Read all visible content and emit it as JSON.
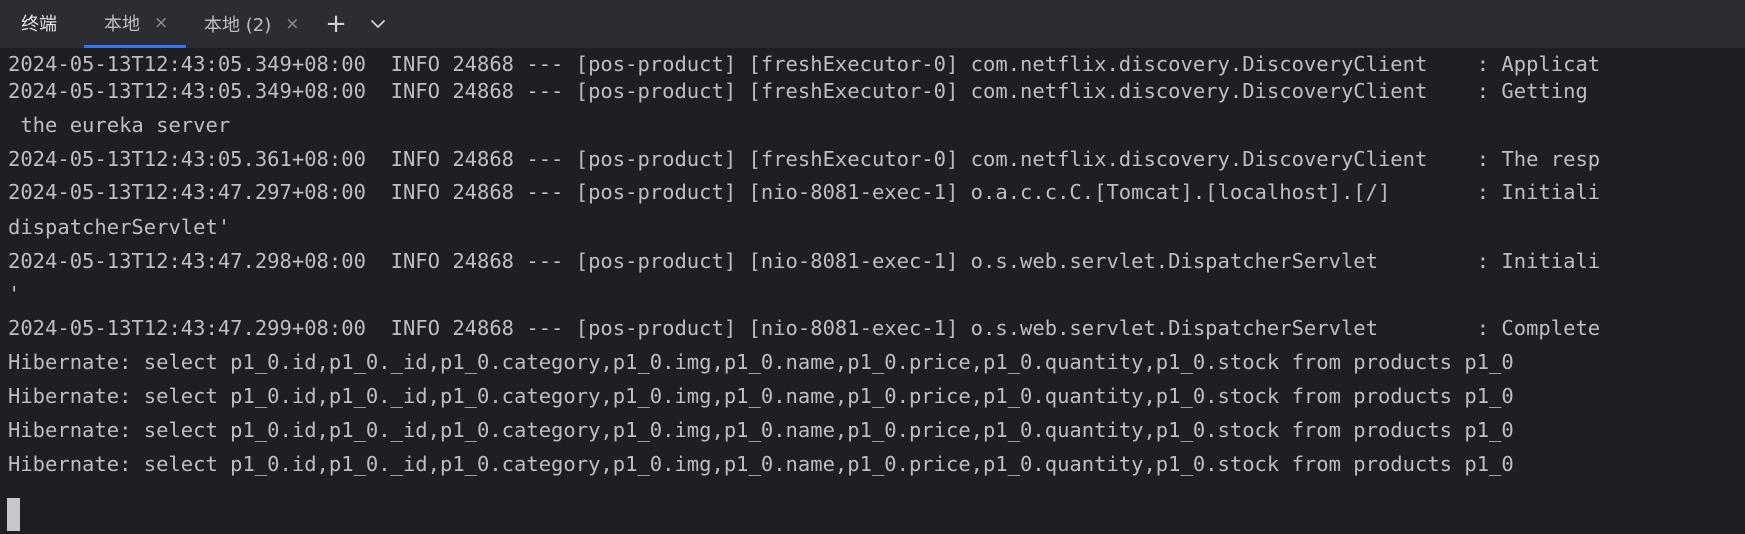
{
  "tool_window": {
    "title": "终端"
  },
  "tabs": [
    {
      "label": "本地",
      "close": "×"
    },
    {
      "label": "本地 (2)",
      "close": "×"
    }
  ],
  "buttons": {
    "add": "+"
  },
  "terminal": {
    "lines": [
      "2024-05-13T12:43:05.349+08:00  INFO 24868 --- [pos-product] [freshExecutor-0] com.netflix.discovery.DiscoveryClient    : Applicat",
      "2024-05-13T12:43:05.349+08:00  INFO 24868 --- [pos-product] [freshExecutor-0] com.netflix.discovery.DiscoveryClient    : Getting",
      " the eureka server",
      "2024-05-13T12:43:05.361+08:00  INFO 24868 --- [pos-product] [freshExecutor-0] com.netflix.discovery.DiscoveryClient    : The resp",
      "2024-05-13T12:43:47.297+08:00  INFO 24868 --- [pos-product] [nio-8081-exec-1] o.a.c.c.C.[Tomcat].[localhost].[/]       : Initiali",
      "dispatcherServlet'",
      "2024-05-13T12:43:47.298+08:00  INFO 24868 --- [pos-product] [nio-8081-exec-1] o.s.web.servlet.DispatcherServlet        : Initiali",
      "'",
      "2024-05-13T12:43:47.299+08:00  INFO 24868 --- [pos-product] [nio-8081-exec-1] o.s.web.servlet.DispatcherServlet        : Complete",
      "Hibernate: select p1_0.id,p1_0._id,p1_0.category,p1_0.img,p1_0.name,p1_0.price,p1_0.quantity,p1_0.stock from products p1_0",
      "Hibernate: select p1_0.id,p1_0._id,p1_0.category,p1_0.img,p1_0.name,p1_0.price,p1_0.quantity,p1_0.stock from products p1_0",
      "Hibernate: select p1_0.id,p1_0._id,p1_0.category,p1_0.img,p1_0.name,p1_0.price,p1_0.quantity,p1_0.stock from products p1_0",
      "Hibernate: select p1_0.id,p1_0._id,p1_0.category,p1_0.img,p1_0.name,p1_0.price,p1_0.quantity,p1_0.stock from products p1_0"
    ]
  }
}
